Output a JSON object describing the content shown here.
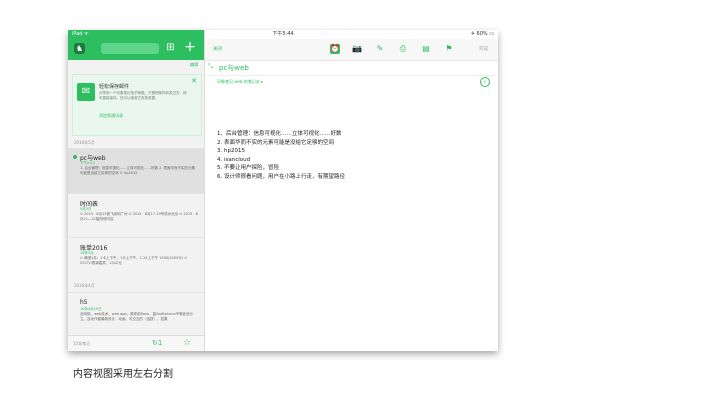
{
  "statusbar": {
    "carrier": "iPad ᯤ",
    "time": "下午5:44",
    "battery": "✈ 60% ▭"
  },
  "sidebar": {
    "edit_label": "编辑",
    "tip": {
      "title": "轻松保存邮件",
      "body": "分享到一个印象笔记电子邮箱，只需把邮件转发过去，即可直接保存。还可以使用它存放收据。",
      "link": "添加到通讯录",
      "close": "✕"
    },
    "months": [
      "2016年5月",
      "2016年4月"
    ],
    "notes": [
      {
        "title": "pc与web",
        "date": "下午5:43",
        "body": "1. 后台管理：信息可视化……立体可视化……好数 2. 表面华而不实的元素可能是没给它足够的空间 3. hp2015",
        "selected": true
      },
      {
        "title": "时间表",
        "date": "5月5日",
        "body": "⊙ 2015 · 8月13首飞深圳广州 ⊙ 2015 · 8月17-19号杭州北京 ⊙ 2015 · 8月21—22猛犸领内容"
      },
      {
        "title": "账单2016",
        "date": "16年5月",
        "body": "⊙ 美团1月：1卡上下午，1卡上下午，1.24上下午 1500(1000卡) ⊙ 51CTO表演嘉宾，1342元"
      },
      {
        "title": "h5",
        "date": "16年4月15日",
        "body": "全网络、web技术、web app、原来用flash、蓝Swiftphone不等处设计立、及动作都最新设计，动画、可交互的（活跃），如果"
      }
    ],
    "bottom": {
      "count": "10条笔记",
      "sync_icon": "↻1",
      "star_icon": "☆"
    }
  },
  "main": {
    "toolbar": {
      "close_label": "关闭",
      "icons": [
        "⏰",
        "📷",
        "✎",
        "⎙",
        "▤",
        "⚑"
      ],
      "done_label": "完成"
    },
    "expand_icon": "⤡",
    "note_title": "pc与web",
    "notebook": "印象笔记.web 的笔记本 ▸",
    "info_icon": "i",
    "content_lines": [
      "1、后台管理：信息可视化……立体可视化……好数",
      "2. 表面华而不实的元素可能是没给它足够的空间",
      "3. hp2015",
      "4. isancloud",
      "5. 不要让用户探险，冒险",
      "6. 设计师很看问题，用户在小路上行走，有期望路径"
    ]
  },
  "caption": "内容视图采用左右分割",
  "colors": {
    "accent": "#2dbe60"
  }
}
